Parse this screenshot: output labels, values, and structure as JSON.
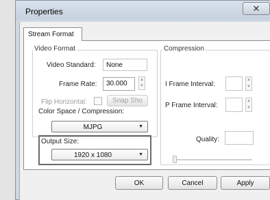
{
  "window": {
    "title": "Properties",
    "close_symbol": "✕"
  },
  "tabs": [
    {
      "label": "Stream Format"
    }
  ],
  "video_format": {
    "group_label": "Video Format",
    "standard_label": "Video Standard:",
    "standard_value": "None",
    "frame_rate_label": "Frame Rate:",
    "frame_rate_value": "30.000",
    "flip_label": "Flip Horizontal:",
    "flip_checked": false,
    "snapshot_label": "Snap Sho",
    "color_space_label": "Color Space / Compression:",
    "color_space_value": "MJPG",
    "output_size_label": "Output Size:",
    "output_size_value": "1920 x 1080"
  },
  "compression": {
    "group_label": "Compression",
    "i_frame_label": "I Frame Interval:",
    "i_frame_value": "",
    "p_frame_label": "P Frame Interval:",
    "p_frame_value": "",
    "quality_label": "Quality:",
    "quality_value": ""
  },
  "buttons": {
    "ok": "OK",
    "cancel": "Cancel",
    "apply": "Apply"
  },
  "icons": {
    "spin_up": "▲",
    "spin_down": "▼",
    "dropdown": "▼"
  }
}
